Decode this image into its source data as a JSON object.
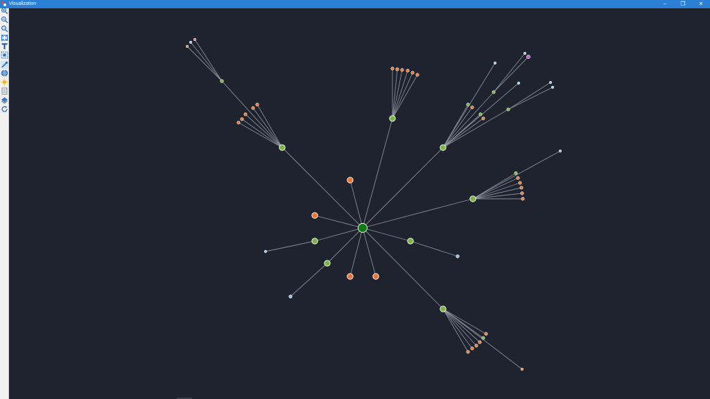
{
  "window": {
    "title": "Visualization",
    "minimize_glyph": "–",
    "restore_glyph": "❐",
    "close_glyph": "✕"
  },
  "toolbar": {
    "tools": [
      {
        "name": "zoom-in-icon",
        "active": false
      },
      {
        "name": "zoom-out-icon",
        "active": false
      },
      {
        "name": "zoom-reset-icon",
        "active": false
      },
      {
        "name": "fit-view-icon",
        "active": false
      },
      {
        "name": "text-tool-icon",
        "glyph": "T",
        "active": false
      },
      {
        "name": "select-area-icon",
        "active": false
      },
      {
        "name": "pointer-tool-icon",
        "active": true
      },
      {
        "name": "globe-icon",
        "active": false
      },
      {
        "name": "sun-icon",
        "active": false
      },
      {
        "name": "page-icon",
        "active": false
      },
      {
        "name": "export-icon",
        "active": false
      },
      {
        "name": "refresh-icon",
        "active": false
      }
    ]
  },
  "graph": {
    "colors": {
      "background": "#1f232e",
      "edge": "#9aa0aa",
      "hub": "#0f7a0f",
      "green": "#7ab541",
      "orange": "#ea7530",
      "blue": "#8cc8ee",
      "purple": "#c35bd8",
      "pink": "#e46d86",
      "node_stroke": "#ffffff"
    }
  }
}
